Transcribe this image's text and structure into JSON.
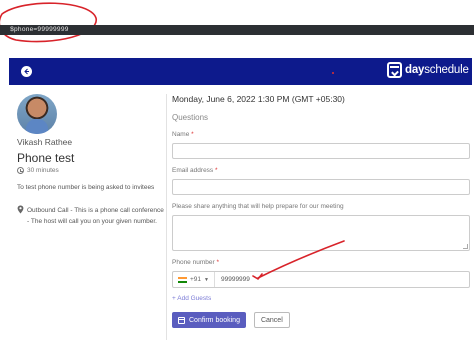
{
  "console": {
    "text": "$phone=99999999"
  },
  "header": {
    "brand_bold": "day",
    "brand_light": "schedule"
  },
  "host": {
    "name": "Vikash Rathee"
  },
  "event": {
    "title": "Phone test",
    "duration": "30 minutes",
    "description": "To test phone number is being asked to invitees",
    "location": "Outbound Call - This is a phone call conference - The host will call you on your given number."
  },
  "booking": {
    "datetime": "Monday, June 6, 2022 1:30 PM (GMT +05:30)",
    "section_title": "Questions",
    "name_label": "Name",
    "email_label": "Email address",
    "notes_label": "Please share anything that will help prepare for our meeting",
    "phone_label": "Phone number",
    "country_code": "+91",
    "phone_value": "99999999",
    "required_mark": "*",
    "add_guests": "+ Add Guests",
    "confirm_label": "Confirm booking",
    "cancel_label": "Cancel"
  },
  "colors": {
    "header_bg": "#0d1a8c",
    "primary_button": "#5a5dbf",
    "annotation": "#d8232a"
  },
  "icons": [
    "back-arrow-icon",
    "dayschedule-logo-icon",
    "clock-icon",
    "location-pin-icon",
    "india-flag-icon",
    "chevron-down-icon",
    "calendar-icon"
  ]
}
